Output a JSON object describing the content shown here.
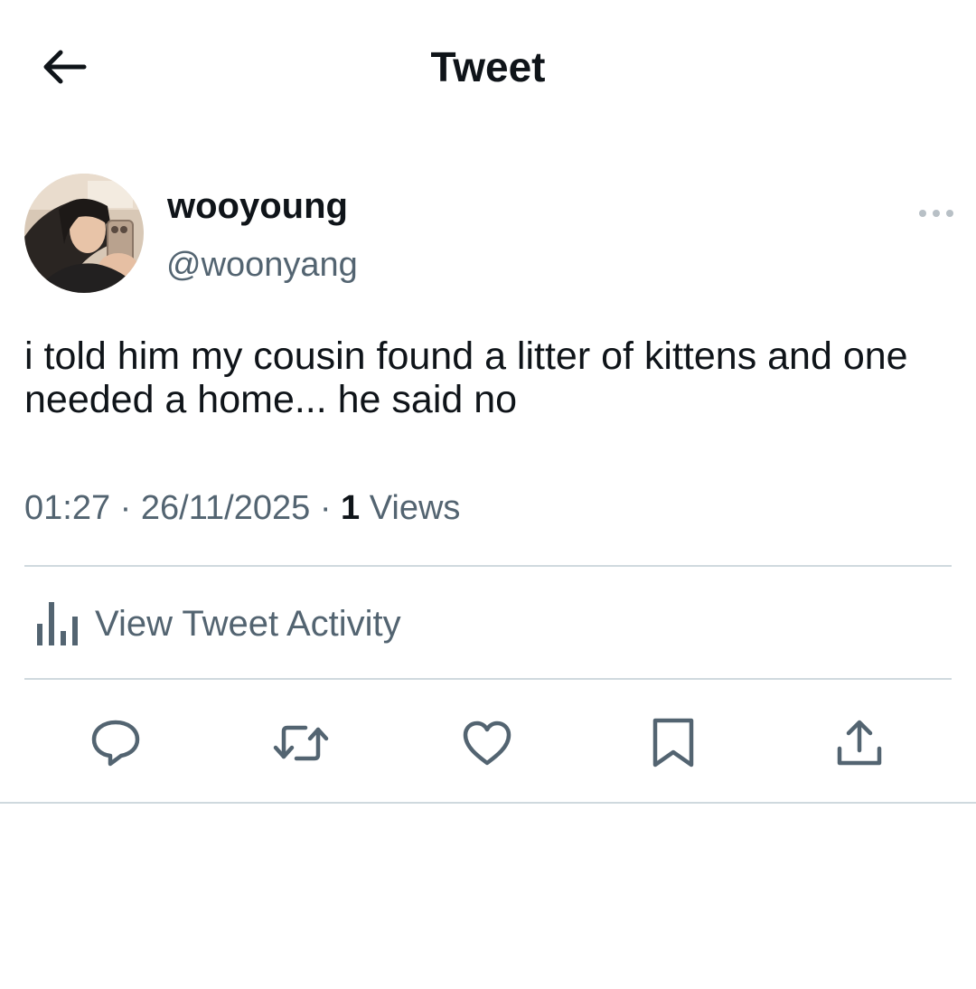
{
  "header": {
    "title": "Tweet",
    "back_icon": "arrow-left-icon"
  },
  "author": {
    "display_name": "wooyoung",
    "handle": "@woonyang",
    "avatar": "profile-photo"
  },
  "tweet": {
    "text": "i told him my cousin found a litter of kittens and one needed a home... he said no",
    "time": "01:27",
    "date": "26/11/2025",
    "separator": "·",
    "views_count": "1",
    "views_label": "Views"
  },
  "activity": {
    "label": "View Tweet Activity",
    "icon": "bar-chart-icon"
  },
  "actions": [
    {
      "name": "reply",
      "icon": "reply-icon"
    },
    {
      "name": "retweet",
      "icon": "retweet-icon"
    },
    {
      "name": "like",
      "icon": "heart-icon"
    },
    {
      "name": "bookmark",
      "icon": "bookmark-icon"
    },
    {
      "name": "share",
      "icon": "share-icon"
    }
  ],
  "colors": {
    "text_primary": "#0f1419",
    "text_secondary": "#536471",
    "divider": "#cfd9de",
    "background": "#ffffff"
  }
}
